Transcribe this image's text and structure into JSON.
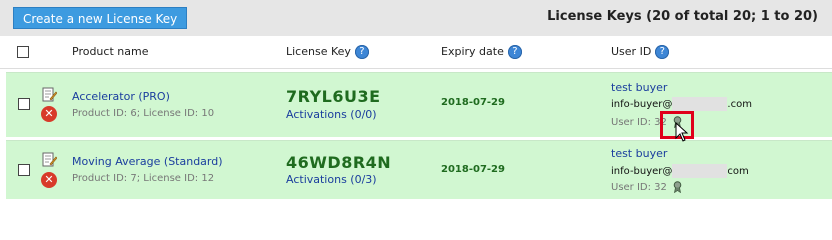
{
  "toolbar": {
    "create_label": "Create a new License Key",
    "title": "License Keys (20 of total 20; 1 to 20)"
  },
  "columns": {
    "product": "Product name",
    "license_key": "License Key",
    "expiry": "Expiry date",
    "user_id": "User ID",
    "help_glyph": "?"
  },
  "rows": [
    {
      "product_name": "Accelerator (PRO)",
      "product_meta": "Product ID: 6; License ID: 10",
      "license_key": "7RYL6U3E",
      "activations": "Activations (0/0)",
      "expiry": "2018-07-29",
      "user_name": "test buyer",
      "email_prefix": "info-buyer@",
      "email_suffix": ".com",
      "user_id": "User ID: 32"
    },
    {
      "product_name": "Moving Average (Standard)",
      "product_meta": "Product ID: 7; License ID: 12",
      "license_key": "46WD8R4N",
      "activations": "Activations (0/3)",
      "expiry": "2018-07-29",
      "user_name": "test buyer",
      "email_prefix": "info-buyer@",
      "email_suffix": "com",
      "user_id": "User ID: 32"
    }
  ],
  "icons": {
    "delete_glyph": "✕"
  },
  "colors": {
    "row_bg": "#d1f7d1",
    "button_bg": "#3d9be0",
    "key_green": "#1f6b1f",
    "link_blue": "#1a3d9e",
    "highlight_red": "#e0001a"
  }
}
